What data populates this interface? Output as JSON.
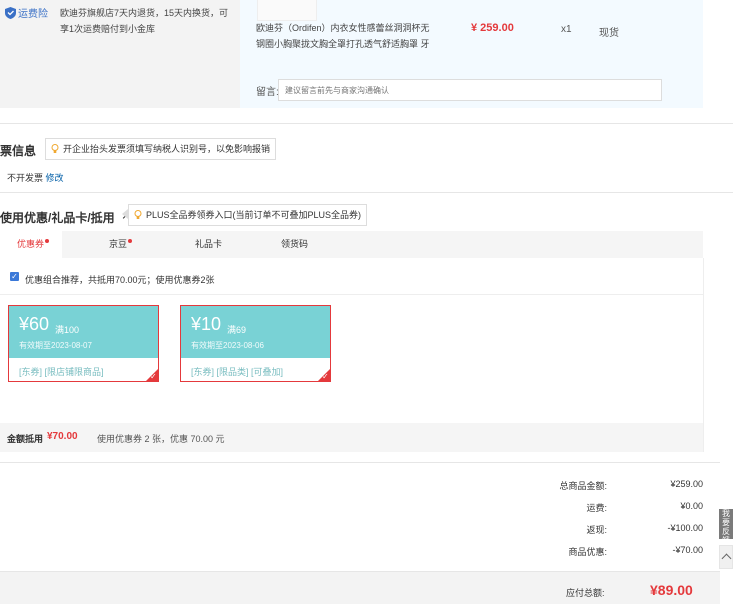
{
  "shipping": {
    "badge": "运费险",
    "text": "欧迪芬旗舰店7天内退货，15天内换货，可享1次运费赔付到小金库"
  },
  "product": {
    "name": "欧迪芬（Ordifen）内衣女性感蕾丝洞洞杯无钢圈小胸聚拢文胸全罩打孔透气舒适胸罩 牙",
    "price": "¥ 259.00",
    "qty": "x1",
    "stock": "现货"
  },
  "memo": {
    "label": "留言:",
    "placeholder": "建议留言前先与商家沟通确认"
  },
  "invoice": {
    "title": "票信息",
    "tip": "开企业抬头发票须填写纳税人识别号，以免影响报销",
    "value": "不开发票",
    "edit": "修改"
  },
  "discount": {
    "title": "使用优惠/礼品卡/抵用",
    "plus_tip": "PLUS全品券领券入口(当前订单不可叠加PLUS全品券)",
    "tabs": [
      {
        "label": "优惠券",
        "dot": true
      },
      {
        "label": "京豆",
        "dot": true
      },
      {
        "label": "礼品卡",
        "dot": false
      },
      {
        "label": "领货码",
        "dot": false
      }
    ],
    "combo_text": "优惠组合推荐，共抵用70.00元；使用优惠券2张",
    "coupons": [
      {
        "amount": "¥60",
        "cond": "满100",
        "valid": "有效期至2023-08-07",
        "tags": "[东券] [限店铺限商品]"
      },
      {
        "amount": "¥10",
        "cond": "满69",
        "valid": "有效期至2023-08-06",
        "tags": "[东券] [限品类] [可叠加]"
      }
    ],
    "summary_label": "金额抵用",
    "summary_amount": "¥70.00",
    "summary_desc": "使用优惠券 2 张，优惠 70.00 元"
  },
  "totals": [
    {
      "label": "总商品金额:",
      "value": "¥259.00"
    },
    {
      "label": "运费:",
      "value": "¥0.00"
    },
    {
      "label": "返现:",
      "value": "-¥100.00"
    },
    {
      "label": "商品优惠:",
      "value": "-¥70.00"
    }
  ],
  "payable": {
    "label": "应付总额:",
    "value": "¥89.00"
  },
  "side": {
    "tab": "我要反馈"
  },
  "colors": {
    "accent_red": "#e4393c",
    "coupon_teal": "#79d2d5",
    "link_blue": "#005ea7"
  }
}
